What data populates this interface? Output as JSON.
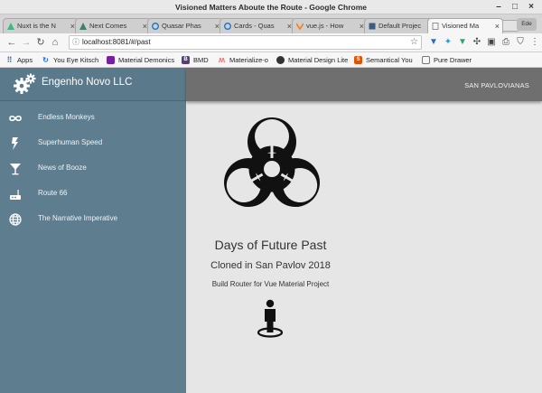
{
  "window": {
    "title": "Visioned Matters Aboute the Route - Google Chrome"
  },
  "tabs": [
    {
      "label": "Nuxt is the N",
      "active": false
    },
    {
      "label": "Next Comes",
      "active": false
    },
    {
      "label": "Quasar Phas",
      "active": false
    },
    {
      "label": "Cards - Quas",
      "active": false
    },
    {
      "label": "vue.js - How",
      "active": false
    },
    {
      "label": "Default Projec",
      "active": false
    },
    {
      "label": "Visioned Ma",
      "active": true
    }
  ],
  "extension_button": {
    "label": "Ede"
  },
  "address": {
    "url": "localhost:8081/#/past"
  },
  "bookmarks": [
    {
      "label": "Apps",
      "icon": "apps-grid-icon"
    },
    {
      "label": "You Eye Kitsch",
      "icon": "refresh-icon"
    },
    {
      "label": "Material Demonics",
      "icon": "material-icon"
    },
    {
      "label": "BMD",
      "icon": "b-icon"
    },
    {
      "label": "Materialize-o",
      "icon": "m-icon"
    },
    {
      "label": "Material Design Lite",
      "icon": "mdl-icon"
    },
    {
      "label": "Semantical You",
      "icon": "su-icon"
    },
    {
      "label": "Pure Drawer",
      "icon": "doc-icon"
    }
  ],
  "sidebar": {
    "title": "Engenho Novo LLC",
    "items": [
      {
        "label": "Endless Monkeys",
        "icon": "infinity-icon"
      },
      {
        "label": "Superhuman Speed",
        "icon": "lightning-icon"
      },
      {
        "label": "News of Booze",
        "icon": "cocktail-icon"
      },
      {
        "label": "Route 66",
        "icon": "router-icon"
      },
      {
        "label": "The Narrative Imperative",
        "icon": "globe-icon"
      }
    ]
  },
  "toolbar": {
    "user": "SAN PAVLOVIANAS"
  },
  "content": {
    "title": "Days of Future Past",
    "subtitle": "Cloned in San Pavlov 2018",
    "caption": "Build Router for Vue Material Project",
    "icon": "biohazard-icon"
  },
  "colors": {
    "sidebar": "#5e7e8f",
    "toolbar": "#6f6f6f",
    "content_bg": "#e6e6e6"
  }
}
